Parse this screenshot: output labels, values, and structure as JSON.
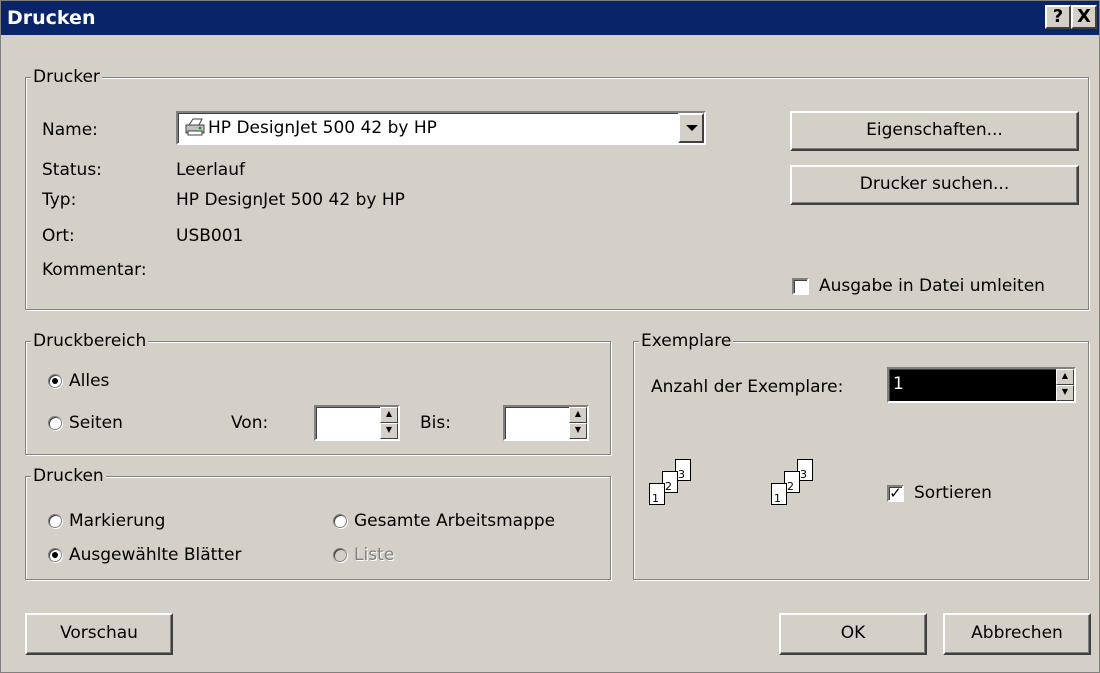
{
  "window": {
    "title": "Drucken",
    "help_button": "?",
    "close_button": "X"
  },
  "printer": {
    "legend": "Drucker",
    "name_label": "Name:",
    "name_value": "HP DesignJet 500 42 by HP",
    "status_label": "Status:",
    "status_value": "Leerlauf",
    "type_label": "Typ:",
    "type_value": "HP DesignJet 500 42 by HP",
    "location_label": "Ort:",
    "location_value": "USB001",
    "comment_label": "Kommentar:",
    "comment_value": "",
    "properties_button": "Eigenschaften...",
    "find_printer_button": "Drucker suchen...",
    "print_to_file_label": "Ausgabe in Datei umleiten",
    "print_to_file_checked": false
  },
  "range": {
    "legend": "Druckbereich",
    "all_label": "Alles",
    "pages_label": "Seiten",
    "from_label": "Von:",
    "to_label": "Bis:",
    "from_value": "",
    "to_value": "",
    "selected": "all"
  },
  "print_what": {
    "legend": "Drucken",
    "selection_label": "Markierung",
    "active_sheets_label": "Ausgewählte Blätter",
    "entire_workbook_label": "Gesamte Arbeitsmappe",
    "list_label": "Liste",
    "selected": "active_sheets"
  },
  "copies": {
    "legend": "Exemplare",
    "count_label": "Anzahl der Exemplare:",
    "count_value": "1",
    "collate_label": "Sortieren",
    "collate_checked": true,
    "page_numbers": [
      "1",
      "2",
      "3"
    ]
  },
  "footer": {
    "preview_button": "Vorschau",
    "ok_button": "OK",
    "cancel_button": "Abbrechen"
  }
}
